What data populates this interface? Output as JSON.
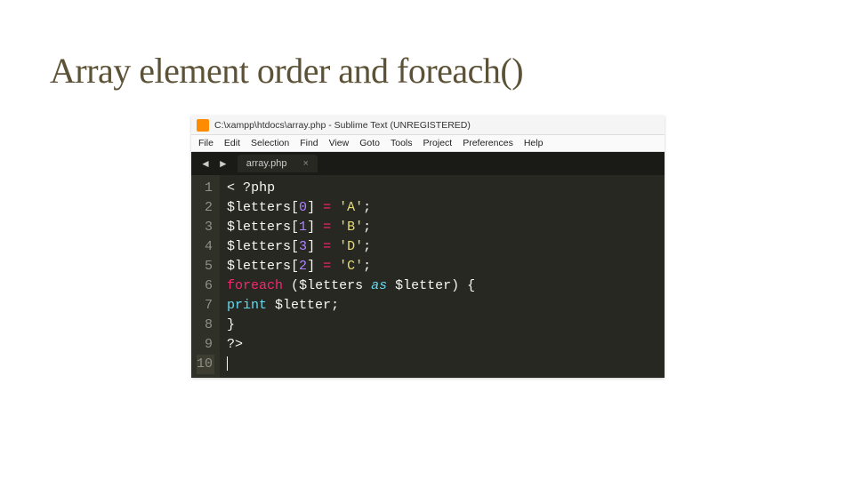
{
  "slide": {
    "title": "Array element order and foreach()"
  },
  "window": {
    "path": "C:\\xampp\\htdocs\\array.php - Sublime Text (UNREGISTERED)"
  },
  "menu": {
    "file": "File",
    "edit": "Edit",
    "selection": "Selection",
    "find": "Find",
    "view": "View",
    "goto": "Goto",
    "tools": "Tools",
    "project": "Project",
    "preferences": "Preferences",
    "help": "Help"
  },
  "tabs": {
    "nav_prev": "◄",
    "nav_next": "►",
    "active_label": "array.php",
    "close": "×"
  },
  "gutter": {
    "l1": "1",
    "l2": "2",
    "l3": "3",
    "l4": "4",
    "l5": "5",
    "l6": "6",
    "l7": "7",
    "l8": "8",
    "l9": "9",
    "l10": "10"
  },
  "code": {
    "open_tag_lt": "<",
    "open_tag_q": "?",
    "open_tag_php": "php",
    "letters": "$letters",
    "lb": "[",
    "rb": "]",
    "idx0": "0",
    "idx1": "1",
    "idx3": "3",
    "idx2": "2",
    "eq": "=",
    "sq": "'",
    "valA": "A",
    "valB": "B",
    "valD": "D",
    "valC": "C",
    "semi": ";",
    "foreach": "foreach",
    "lpar": "(",
    "rpar": ")",
    "as": "as",
    "letter": "$letter",
    "lbrace": "{",
    "rbrace": "}",
    "print": "print",
    "close_tag": "?>"
  }
}
